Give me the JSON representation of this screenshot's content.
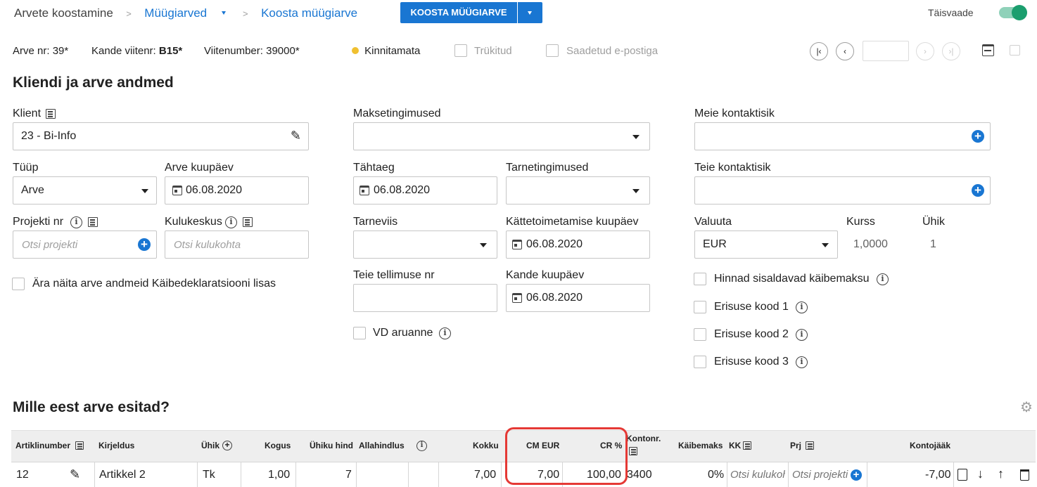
{
  "header": {
    "breadcrumb_root": "Arvete koostamine",
    "breadcrumb_sep1": ">",
    "breadcrumb_mid": "Müügiarved",
    "breadcrumb_sep2": ">",
    "breadcrumb_current": "Koosta müügiarve",
    "primary_button": "KOOSTA MÜÜGIARVE",
    "fullview_label": "Täisvaade"
  },
  "status_bar": {
    "invoice_no_label": "Arve nr:",
    "invoice_no_value": "39*",
    "entry_ref_label": "Kande viitenr:",
    "entry_ref_value": "B15*",
    "ref_number_label": "Viitenumber:",
    "ref_number_value": "39000*",
    "status_text": "Kinnitamata",
    "printed_label": "Trükitud",
    "emailed_label": "Saadetud e-postiga"
  },
  "section1": {
    "title": "Kliendi ja arve andmed",
    "client_label": "Klient",
    "client_value": "23 - Bi-Info",
    "type_label": "Tüüp",
    "type_value": "Arve",
    "invoice_date_label": "Arve kuupäev",
    "invoice_date_value": "06.08.2020",
    "project_label": "Projekti nr",
    "project_placeholder": "Otsi projekti",
    "cost_center_label": "Kulukeskus",
    "cost_center_placeholder": "Otsi kulukohta",
    "vat_decl_label": "Ära näita arve andmeid Käibedeklaratsiooni lisas",
    "payment_terms_label": "Maksetingimused",
    "due_date_label": "Tähtaeg",
    "due_date_value": "06.08.2020",
    "delivery_terms_label": "Tarnetingimused",
    "delivery_method_label": "Tarneviis",
    "handover_date_label": "Kättetoimetamise kuupäev",
    "handover_date_value": "06.08.2020",
    "order_no_label": "Teie tellimuse nr",
    "entry_date_label": "Kande kuupäev",
    "entry_date_value": "06.08.2020",
    "vd_label": "VD aruanne",
    "our_contact_label": "Meie kontaktisik",
    "your_contact_label": "Teie kontaktisik",
    "currency_label": "Valuuta",
    "currency_value": "EUR",
    "rate_label": "Kurss",
    "rate_value": "1,0000",
    "unit_label": "Ühik",
    "unit_value": "1",
    "prices_incl_vat_label": "Hinnad sisaldavad käibemaksu",
    "special_code1_label": "Erisuse kood 1",
    "special_code2_label": "Erisuse kood 2",
    "special_code3_label": "Erisuse kood 3"
  },
  "section2": {
    "title": "Mille eest arve esitad?",
    "columns": {
      "article": "Artiklinumber",
      "description": "Kirjeldus",
      "unit": "Ühik",
      "quantity": "Kogus",
      "unit_price": "Ühiku hind",
      "discount": "Allahindlus",
      "total": "Kokku",
      "cm_eur": "CM EUR",
      "cr_pct": "CR %",
      "account_no": "Kontonr.",
      "vat": "Käibemaks",
      "kk": "KK",
      "prj": "Prj",
      "balance": "Kontojääk"
    },
    "row": {
      "article": "12",
      "description": "Artikkel 2",
      "unit": "Tk",
      "quantity": "1,00",
      "unit_price": "7",
      "total": "7,00",
      "cm_eur": "7,00",
      "cr_pct": "100,00",
      "account_no": "3400",
      "vat": "0%",
      "kk_placeholder": "Otsi kulukoht",
      "prj_placeholder": "Otsi projekti",
      "balance": "-7,00"
    }
  },
  "colors": {
    "accent": "#1976d2",
    "toggle_on": "#1b9e6e",
    "status_dot": "#f0c030",
    "highlight": "#e53935"
  }
}
